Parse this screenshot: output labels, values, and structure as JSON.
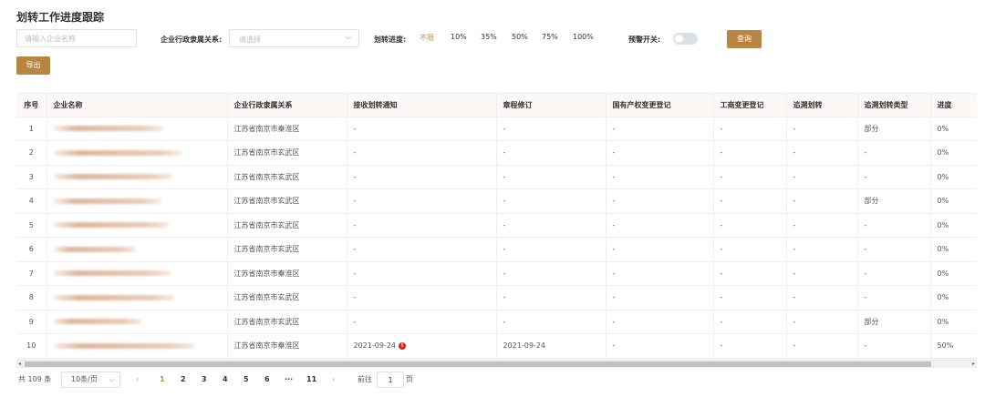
{
  "title": "划转工作进度跟踪",
  "filters": {
    "company_placeholder": "请输入企业名称",
    "admin_label": "企业行政隶属关系:",
    "admin_placeholder": "请选择",
    "progress_label": "划转进度:",
    "progress_options": [
      "不限",
      "10%",
      "35%",
      "50%",
      "75%",
      "100%"
    ],
    "progress_selected": "不限",
    "warning_label": "预警开关:",
    "warning_on": false,
    "query_label": "查询"
  },
  "export_label": "导出",
  "table": {
    "headers": [
      "序号",
      "企业名称",
      "企业行政隶属关系",
      "接收划转通知",
      "章程修订",
      "国有产权变更登记",
      "工商变更登记",
      "追溯划转",
      "追溯划转类型",
      "进度"
    ],
    "rows": [
      {
        "idx": "1",
        "region": "江苏省南京市秦淮区",
        "notice": "-",
        "charter": "-",
        "state_reg": "-",
        "biz_reg": "-",
        "trace": "-",
        "trace_type": "部分",
        "progress": "0%",
        "alert": false
      },
      {
        "idx": "2",
        "region": "江苏省南京市玄武区",
        "notice": "-",
        "charter": "-",
        "state_reg": "-",
        "biz_reg": "-",
        "trace": "-",
        "trace_type": "-",
        "progress": "0%",
        "alert": false
      },
      {
        "idx": "3",
        "region": "江苏省南京市玄武区",
        "notice": "-",
        "charter": "-",
        "state_reg": "-",
        "biz_reg": "-",
        "trace": "-",
        "trace_type": "-",
        "progress": "0%",
        "alert": false
      },
      {
        "idx": "4",
        "region": "江苏省南京市玄武区",
        "notice": "-",
        "charter": "-",
        "state_reg": "-",
        "biz_reg": "-",
        "trace": "-",
        "trace_type": "部分",
        "progress": "0%",
        "alert": false
      },
      {
        "idx": "5",
        "region": "江苏省南京市玄武区",
        "notice": "-",
        "charter": "-",
        "state_reg": "-",
        "biz_reg": "-",
        "trace": "-",
        "trace_type": "-",
        "progress": "0%",
        "alert": false
      },
      {
        "idx": "6",
        "region": "江苏省南京市玄武区",
        "notice": "-",
        "charter": "-",
        "state_reg": "-",
        "biz_reg": "-",
        "trace": "-",
        "trace_type": "-",
        "progress": "0%",
        "alert": false
      },
      {
        "idx": "7",
        "region": "江苏省南京市秦淮区",
        "notice": "-",
        "charter": "-",
        "state_reg": "-",
        "biz_reg": "-",
        "trace": "-",
        "trace_type": "-",
        "progress": "0%",
        "alert": false
      },
      {
        "idx": "8",
        "region": "江苏省南京市玄武区",
        "notice": "-",
        "charter": "-",
        "state_reg": "-",
        "biz_reg": "-",
        "trace": "-",
        "trace_type": "-",
        "progress": "0%",
        "alert": false
      },
      {
        "idx": "9",
        "region": "江苏省南京市玄武区",
        "notice": "-",
        "charter": "-",
        "state_reg": "-",
        "biz_reg": "-",
        "trace": "-",
        "trace_type": "部分",
        "progress": "0%",
        "alert": false
      },
      {
        "idx": "10",
        "region": "江苏省南京市秦淮区",
        "notice": "2021-09-24",
        "charter": "2021-09-24",
        "state_reg": "-",
        "biz_reg": "-",
        "trace": "-",
        "trace_type": "-",
        "progress": "50%",
        "alert": true
      }
    ]
  },
  "pagination": {
    "total_text": "共 109 条",
    "page_size": "10条/页",
    "pages": [
      "1",
      "2",
      "3",
      "4",
      "5",
      "6",
      "···",
      "11"
    ],
    "current_page": "1",
    "goto_label": "前往",
    "goto_value": "1",
    "page_suffix": "页"
  },
  "colors": {
    "accent": "#c08a48",
    "button": "#b98543",
    "alert": "#d9251c",
    "header_bg": "#fbf8f5"
  },
  "icons": {
    "select_arrow": "chevron-down-icon",
    "alert": "exclamation-circle-icon",
    "prev": "chevron-left-icon",
    "next": "chevron-right-icon"
  }
}
